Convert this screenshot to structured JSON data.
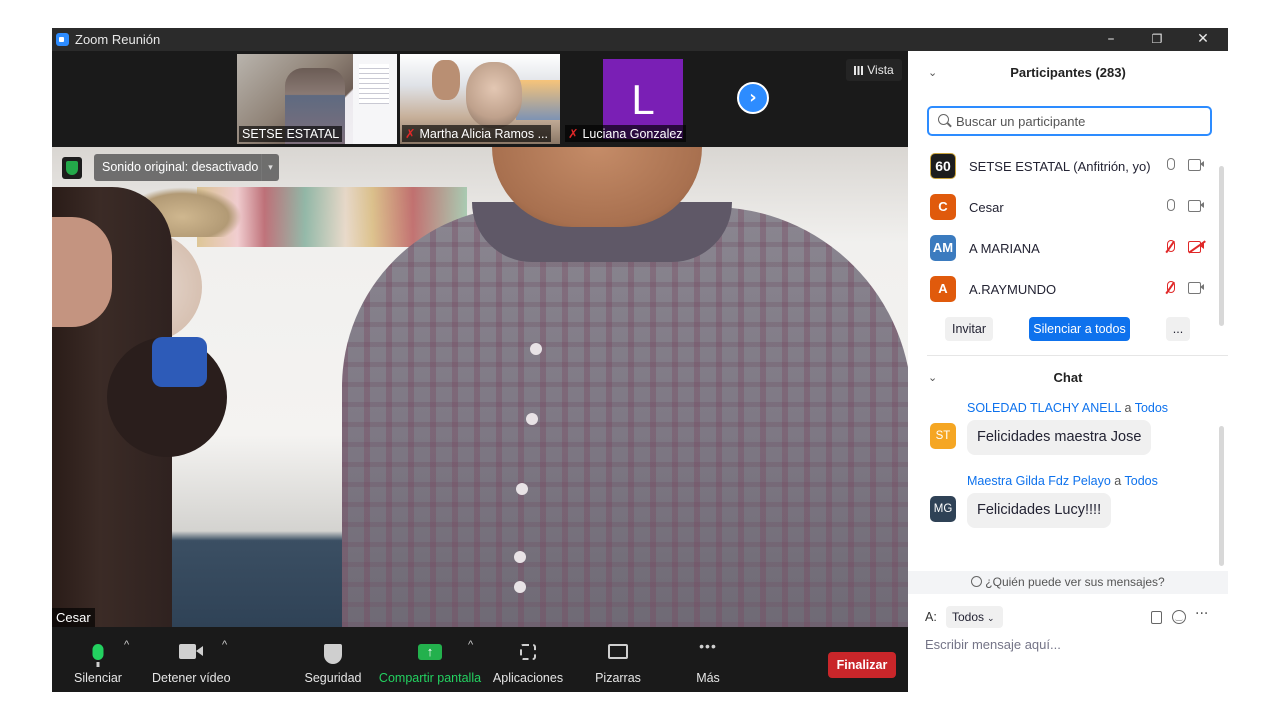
{
  "window": {
    "title": "Zoom Reunión",
    "minimize": "–",
    "restore": "❐",
    "close": "✕"
  },
  "thumbnails": [
    {
      "name": "SETSE ESTATAL",
      "muted": false
    },
    {
      "name": "Martha Alicia Ramos ...",
      "muted": true
    },
    {
      "name": "Luciana Gonzalez",
      "muted": true,
      "avatar_letter": "L",
      "avatar_color": "#7a1fb5"
    }
  ],
  "next_page_icon": "›",
  "view_button": "Vista",
  "main_video": {
    "sound_pill": "Sonido original: desactivado",
    "caret": "▾",
    "speaker_name": "Cesar"
  },
  "toolbar": {
    "mute": "Silenciar",
    "stop_video": "Detener vídeo",
    "security": "Seguridad",
    "share": "Compartir pantalla",
    "share_icon": "↑",
    "apps": "Aplicaciones",
    "whiteboards": "Pizarras",
    "more": "Más",
    "more_icon": "•••",
    "chevron": "^",
    "end": "Finalizar"
  },
  "participants": {
    "title": "Participantes (283)",
    "collapse_icon": "⌄",
    "search_placeholder": "Buscar un participante",
    "list": [
      {
        "name": "SETSE ESTATAL (Anfitrión, yo)",
        "avatar": "60",
        "color": "#1d1d1d",
        "mic_off": false,
        "cam_off": false
      },
      {
        "name": "Cesar",
        "avatar": "C",
        "color": "#e8620f",
        "mic_off": false,
        "cam_off": false
      },
      {
        "name": "A MARIANA",
        "avatar": "AM",
        "color": "#3b7bbf",
        "mic_off": true,
        "cam_off": true
      },
      {
        "name": "A.RAYMUNDO",
        "avatar": "A",
        "color": "#e8620f",
        "mic_off": true,
        "cam_off": false
      }
    ],
    "invite": "Invitar",
    "mute_all": "Silenciar a todos",
    "more": "..."
  },
  "chat": {
    "title": "Chat",
    "messages": [
      {
        "avatar": "ST",
        "color": "#f5a623",
        "from": "SOLEDAD TLACHY ANELL",
        "to": "a",
        "to_target": "Todos",
        "text": "Felicidades maestra Jose"
      },
      {
        "avatar": "MG",
        "color": "#2f4256",
        "from": "Maestra Gilda Fdz Pelayo",
        "to": "a",
        "to_target": "Todos",
        "text": "Felicidades Lucy!!!!"
      }
    ],
    "who_sees": "¿Quién puede ver sus mensajes?",
    "to_label": "A:",
    "to_value": "Todos",
    "to_chevron": "⌄",
    "more_icon": "···",
    "input_placeholder": "Escribir mensaje aquí..."
  }
}
